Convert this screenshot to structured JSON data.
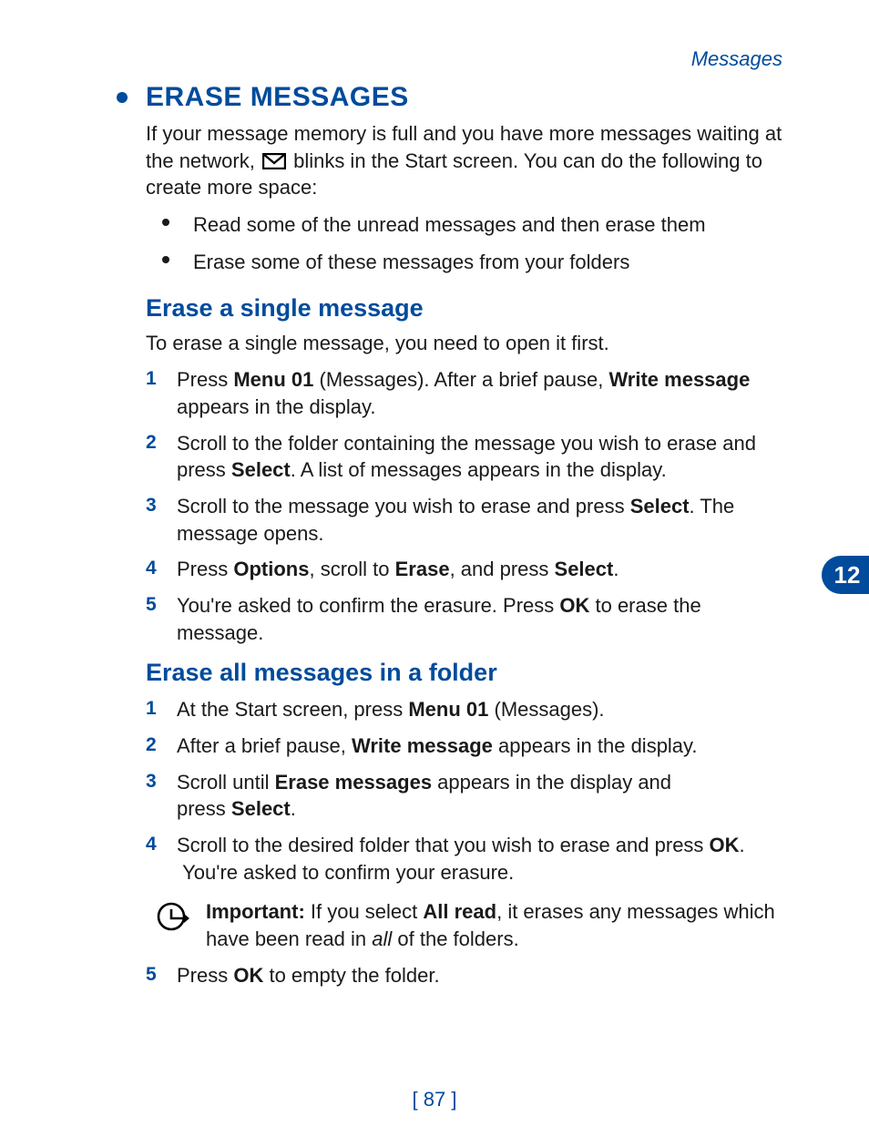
{
  "header": {
    "section": "Messages"
  },
  "chapter_tab": "12",
  "page_number": "[ 87 ]",
  "h1": "ERASE MESSAGES",
  "intro": {
    "pre": "If your message memory is full and you have more messages waiting at the network, ",
    "post": " blinks in the Start screen. You can do the following to create more space:"
  },
  "intro_bullets": [
    "Read some of the unread messages and then erase them",
    "Erase some of these messages from your folders"
  ],
  "sec1_title": "Erase a single message",
  "sec1_intro": "To erase a single message, you need to open it first.",
  "sec1_steps": [
    {
      "num": "1",
      "html": "Press <b>Menu 01</b> (Messages). After a brief pause, <b>Write message</b> appears in the display."
    },
    {
      "num": "2",
      "html": "Scroll to the folder containing the message you wish to erase and press <b>Select</b>. A list of messages appears in the display."
    },
    {
      "num": "3",
      "html": "Scroll to the message you wish to erase and press <b>Select</b>. The message opens."
    },
    {
      "num": "4",
      "html": "Press <b>Options</b>, scroll to <b>Erase</b>, and press <b>Select</b>."
    },
    {
      "num": "5",
      "html": "You're asked to confirm the erasure. Press <b>OK</b> to erase the message."
    }
  ],
  "sec2_title": "Erase all messages in a folder",
  "sec2_steps": [
    {
      "num": "1",
      "html": "At the Start screen, press <b>Menu 01</b> (Messages)."
    },
    {
      "num": "2",
      "html": "After a brief pause, <b>Write message</b> appears in the display."
    },
    {
      "num": "3",
      "html": "Scroll until <b>Erase messages</b> appears in the display and press&nbsp;<b>Select</b>."
    },
    {
      "num": "4",
      "html": "Scroll to the desired folder that you wish to erase and press <b>OK</b>. &nbsp;You're asked to confirm your erasure."
    }
  ],
  "important_note": "<b>Important:</b> If you select <b>All read</b>, it erases any messages which have been read in <i>all</i> of the folders.",
  "sec2_last_step": {
    "num": "5",
    "html": "Press <b>OK</b> to empty the folder."
  }
}
